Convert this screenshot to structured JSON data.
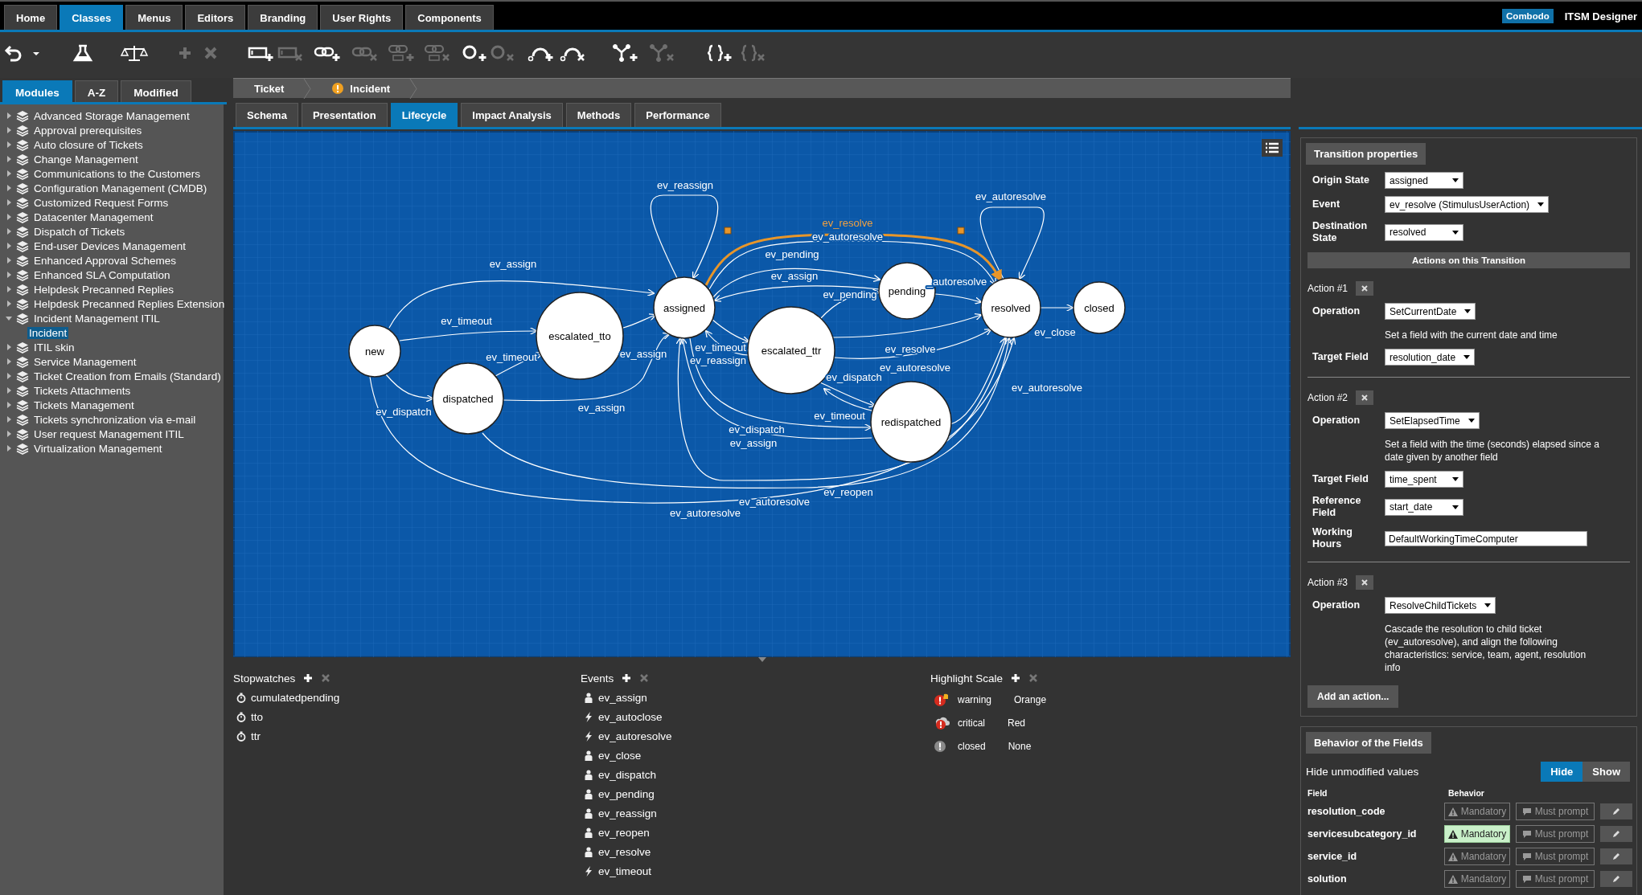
{
  "menu_tabs": [
    {
      "label": "Home",
      "selected": false
    },
    {
      "label": "Classes",
      "selected": true
    },
    {
      "label": "Menus",
      "selected": false
    },
    {
      "label": "Editors",
      "selected": false
    },
    {
      "label": "Branding",
      "selected": false
    },
    {
      "label": "User Rights",
      "selected": false
    },
    {
      "label": "Components",
      "selected": false
    }
  ],
  "brand": {
    "badge": "Combodo",
    "title": "ITSM Designer"
  },
  "toolbar": [
    {
      "disabled": false
    },
    {
      "disabled": false
    },
    {
      "disabled": false
    },
    {
      "disabled": true
    },
    {
      "disabled": true
    },
    {
      "disabled": false
    },
    {
      "disabled": true
    },
    {
      "disabled": false
    },
    {
      "disabled": true
    },
    {
      "disabled": true
    },
    {
      "disabled": true
    },
    {
      "disabled": false
    },
    {
      "disabled": true
    },
    {
      "disabled": false
    },
    {
      "disabled": false
    },
    {
      "disabled": false
    },
    {
      "disabled": true
    },
    {
      "disabled": false
    },
    {
      "disabled": true
    }
  ],
  "sidebar": {
    "tabs": [
      {
        "label": "Modules",
        "selected": true
      },
      {
        "label": "A-Z",
        "selected": false
      },
      {
        "label": "Modified",
        "selected": false
      }
    ],
    "items": [
      {
        "label": "Advanced Storage Management",
        "expanded": false,
        "selected": false
      },
      {
        "label": "Approval prerequisites",
        "expanded": false,
        "selected": false
      },
      {
        "label": "Auto closure of Tickets",
        "expanded": false,
        "selected": false
      },
      {
        "label": "Change Management",
        "expanded": false,
        "selected": false
      },
      {
        "label": "Communications to the Customers",
        "expanded": false,
        "selected": false
      },
      {
        "label": "Configuration Management (CMDB)",
        "expanded": false,
        "selected": false
      },
      {
        "label": "Customized Request Forms",
        "expanded": false,
        "selected": false
      },
      {
        "label": "Datacenter Management",
        "expanded": false,
        "selected": false
      },
      {
        "label": "Dispatch of Tickets",
        "expanded": false,
        "selected": false
      },
      {
        "label": "End-user Devices Management",
        "expanded": false,
        "selected": false
      },
      {
        "label": "Enhanced Approval Schemes",
        "expanded": false,
        "selected": false
      },
      {
        "label": "Enhanced SLA Computation",
        "expanded": false,
        "selected": false
      },
      {
        "label": "Helpdesk Precanned Replies",
        "expanded": false,
        "selected": false
      },
      {
        "label": "Helpdesk Precanned Replies Extension",
        "expanded": false,
        "selected": false
      },
      {
        "label": "Incident Management ITIL",
        "expanded": true,
        "selected": false,
        "children": [
          {
            "label": "Incident",
            "selected": true
          }
        ]
      },
      {
        "label": "ITIL skin",
        "expanded": false,
        "selected": false
      },
      {
        "label": "Service Management",
        "expanded": false,
        "selected": false
      },
      {
        "label": "Ticket Creation from Emails (Standard)",
        "expanded": false,
        "selected": false
      },
      {
        "label": "Tickets Attachments",
        "expanded": false,
        "selected": false
      },
      {
        "label": "Tickets Management",
        "expanded": false,
        "selected": false
      },
      {
        "label": "Tickets synchronization via e-mail",
        "expanded": false,
        "selected": false
      },
      {
        "label": "User request Management ITIL",
        "expanded": false,
        "selected": false
      },
      {
        "label": "Virtualization Management",
        "expanded": false,
        "selected": false
      }
    ]
  },
  "breadcrumb": [
    {
      "label": "Ticket",
      "kind": "plain"
    },
    {
      "label": "Incident",
      "kind": "warning"
    }
  ],
  "tabs": [
    {
      "label": "Schema",
      "selected": false
    },
    {
      "label": "Presentation",
      "selected": false
    },
    {
      "label": "Lifecycle",
      "selected": true
    },
    {
      "label": "Impact Analysis",
      "selected": false
    },
    {
      "label": "Methods",
      "selected": false
    },
    {
      "label": "Performance",
      "selected": false
    }
  ],
  "diagram": {
    "states": [
      {
        "label": "new"
      },
      {
        "label": "dispatched"
      },
      {
        "label": "escalated_tto"
      },
      {
        "label": "assigned"
      },
      {
        "label": "pending"
      },
      {
        "label": "escalated_ttr"
      },
      {
        "label": "redispatched"
      },
      {
        "label": "resolved"
      },
      {
        "label": "closed"
      }
    ],
    "transitions": [
      {
        "label": "ev_reassign",
        "selected": false
      },
      {
        "label": "ev_autoresolve",
        "selected": false
      },
      {
        "label": "ev_resolve",
        "selected": true
      },
      {
        "label": "ev_autoresolve",
        "selected": false
      },
      {
        "label": "ev_pending",
        "selected": false
      },
      {
        "label": "ev_assign",
        "selected": false
      },
      {
        "label": "ev_assign",
        "selected": false
      },
      {
        "label": "ev_timeout",
        "selected": false
      },
      {
        "label": "ev_timeout",
        "selected": false
      },
      {
        "label": "ev_assign",
        "selected": false
      },
      {
        "label": "ev_dispatch",
        "selected": false
      },
      {
        "label": "ev_assign",
        "selected": false
      },
      {
        "label": "ev_pending",
        "selected": false
      },
      {
        "label": "_autoresolve",
        "selected": false
      },
      {
        "label": "ev_timeout",
        "selected": false
      },
      {
        "label": "ev_reassign",
        "selected": false
      },
      {
        "label": "ev_resolve",
        "selected": false
      },
      {
        "label": "ev_autoresolve",
        "selected": false
      },
      {
        "label": "ev_dispatch",
        "selected": false
      },
      {
        "label": "ev_autoresolve",
        "selected": false
      },
      {
        "label": "ev_timeout",
        "selected": false
      },
      {
        "label": "ev_dispatch",
        "selected": false
      },
      {
        "label": "ev_assign",
        "selected": false
      },
      {
        "label": "ev_close",
        "selected": false
      },
      {
        "label": "ev_reopen",
        "selected": false
      },
      {
        "label": "ev_autoresolve",
        "selected": false
      },
      {
        "label": "ev_autoresolve",
        "selected": false
      }
    ]
  },
  "stopwatches": {
    "title": "Stopwatches",
    "items": [
      "cumulatedpending",
      "tto",
      "ttr"
    ]
  },
  "events": {
    "title": "Events",
    "items": [
      {
        "label": "ev_assign",
        "kind": "user"
      },
      {
        "label": "ev_autoclose",
        "kind": "auto"
      },
      {
        "label": "ev_autoresolve",
        "kind": "auto"
      },
      {
        "label": "ev_close",
        "kind": "user"
      },
      {
        "label": "ev_dispatch",
        "kind": "user"
      },
      {
        "label": "ev_pending",
        "kind": "user"
      },
      {
        "label": "ev_reassign",
        "kind": "user"
      },
      {
        "label": "ev_reopen",
        "kind": "user"
      },
      {
        "label": "ev_resolve",
        "kind": "user"
      },
      {
        "label": "ev_timeout",
        "kind": "auto"
      }
    ]
  },
  "highlight_scale": {
    "title": "Highlight Scale",
    "items": [
      {
        "name": "warning",
        "value": "Orange",
        "kind": "warning"
      },
      {
        "name": "critical",
        "value": "Red",
        "kind": "critical"
      },
      {
        "name": "closed",
        "value": "None",
        "kind": "closed"
      }
    ]
  },
  "transition_properties": {
    "title": "Transition properties",
    "fields": [
      {
        "label": "Origin State",
        "value": "assigned"
      },
      {
        "label": "Event",
        "value": "ev_resolve (StimulusUserAction)"
      },
      {
        "label": "Destination State",
        "value": "resolved"
      }
    ],
    "actions_title": "Actions on this Transition",
    "actions": [
      {
        "title": "Action #1",
        "fields": [
          {
            "kind": "select",
            "label": "Operation",
            "value": "SetCurrentDate"
          },
          {
            "kind": "note",
            "text": "Set a field with the current date and time"
          },
          {
            "kind": "select",
            "label": "Target Field",
            "value": "resolution_date"
          }
        ]
      },
      {
        "title": "Action #2",
        "fields": [
          {
            "kind": "select",
            "label": "Operation",
            "value": "SetElapsedTime"
          },
          {
            "kind": "note",
            "text": "Set a field with the time (seconds) elapsed since a date given by another field"
          },
          {
            "kind": "select",
            "label": "Target Field",
            "value": "time_spent"
          },
          {
            "kind": "select",
            "label": "Reference Field",
            "value": "start_date"
          },
          {
            "kind": "input",
            "label": "Working Hours",
            "value": "DefaultWorkingTimeComputer"
          }
        ]
      },
      {
        "title": "Action #3",
        "fields": [
          {
            "kind": "select",
            "label": "Operation",
            "value": "ResolveChildTickets"
          },
          {
            "kind": "note",
            "text": "Cascade the resolution to child ticket (ev_autoresolve), and align the following characteristics: service, team, agent, resolution info"
          }
        ]
      }
    ],
    "add_button": "Add an action..."
  },
  "field_behavior": {
    "title": "Behavior of the Fields",
    "hide_label": "Hide unmodified values",
    "toggle": [
      {
        "label": "Hide",
        "selected": true
      },
      {
        "label": "Show",
        "selected": false
      }
    ],
    "columns": [
      "Field",
      "Behavior"
    ],
    "rows": [
      {
        "field": "resolution_code",
        "mandatory_label": "Mandatory",
        "mandatory": false,
        "prompt_label": "Must prompt",
        "must_prompt": false
      },
      {
        "field": "servicesubcategory_id",
        "mandatory_label": "Mandatory",
        "mandatory": true,
        "prompt_label": "Must prompt",
        "must_prompt": false
      },
      {
        "field": "service_id",
        "mandatory_label": "Mandatory",
        "mandatory": false,
        "prompt_label": "Must prompt",
        "must_prompt": false
      },
      {
        "field": "solution",
        "mandatory_label": "Mandatory",
        "mandatory": false,
        "prompt_label": "Must prompt",
        "must_prompt": false
      }
    ]
  }
}
